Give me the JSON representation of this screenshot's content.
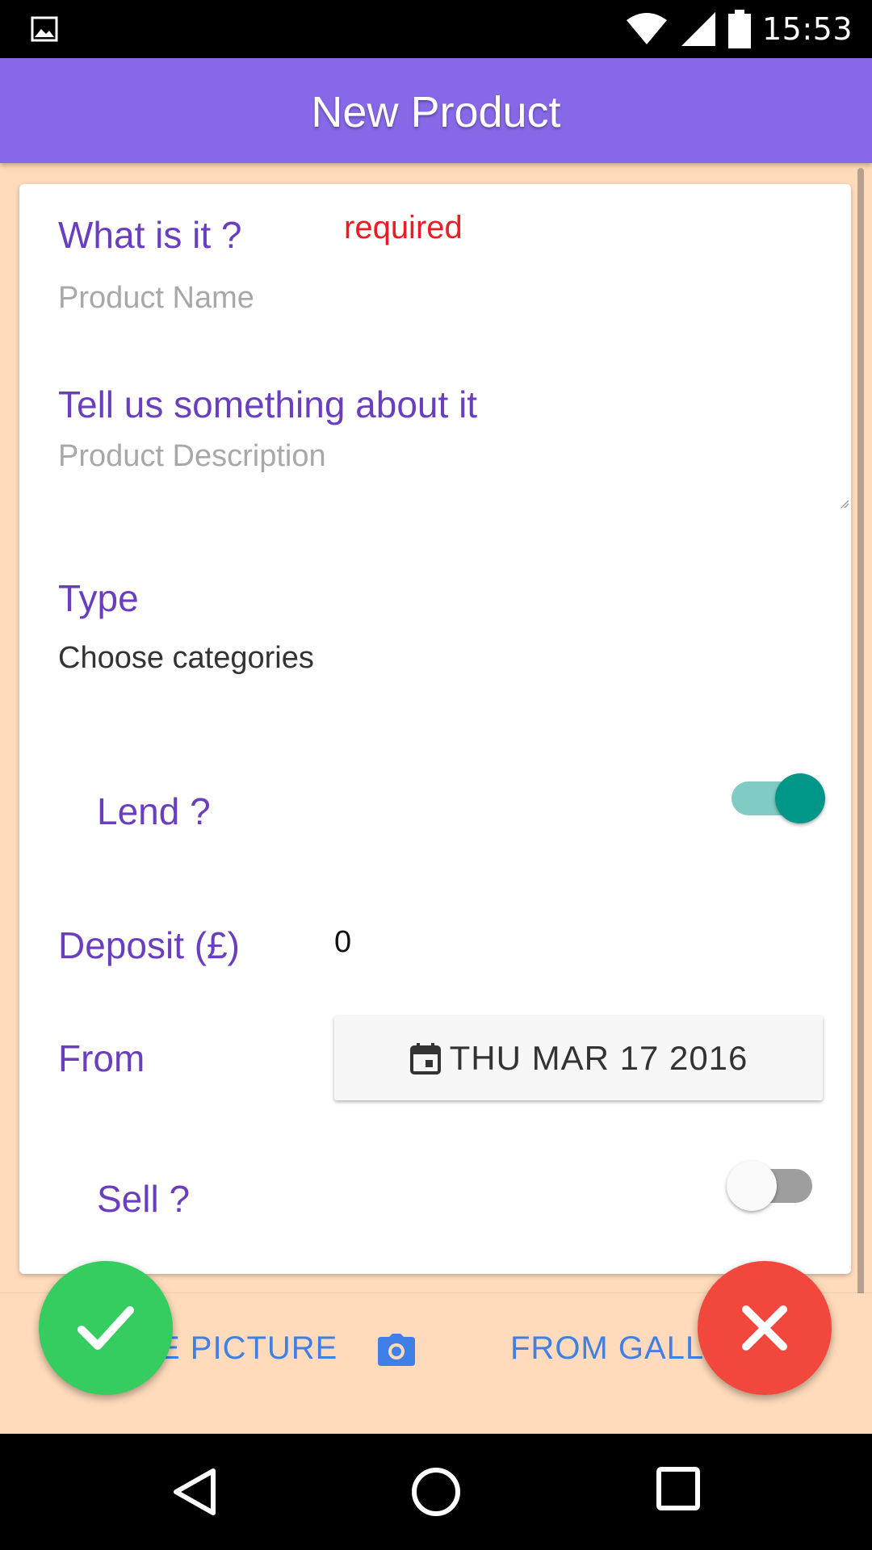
{
  "status_bar": {
    "time": "15:53",
    "icons": [
      "image-icon",
      "wifi-icon",
      "signal-icon",
      "battery-icon"
    ]
  },
  "app_bar": {
    "title": "New Product"
  },
  "form": {
    "name_label": "What is it ?",
    "name_required": "required",
    "name_placeholder": "Product Name",
    "description_label": "Tell us something about it",
    "description_placeholder": "Product Description",
    "type_label": "Type",
    "type_value": "Choose categories",
    "lend_label": "Lend ?",
    "lend_on": true,
    "deposit_label": "Deposit (£)",
    "deposit_value": "0",
    "from_label": "From",
    "from_date": "THU MAR 17 2016",
    "sell_label": "Sell ?",
    "sell_on": false
  },
  "actions": {
    "take_picture": "E PICTURE",
    "from_gallery": "FROM GALL"
  },
  "colors": {
    "app_bar": "#8769e8",
    "label": "#6a3fbf",
    "required": "#ec1c24",
    "toggle_on": "#009688",
    "confirm_fab": "#36cd60",
    "cancel_fab": "#f2473c",
    "background": "#ffdbbb"
  }
}
